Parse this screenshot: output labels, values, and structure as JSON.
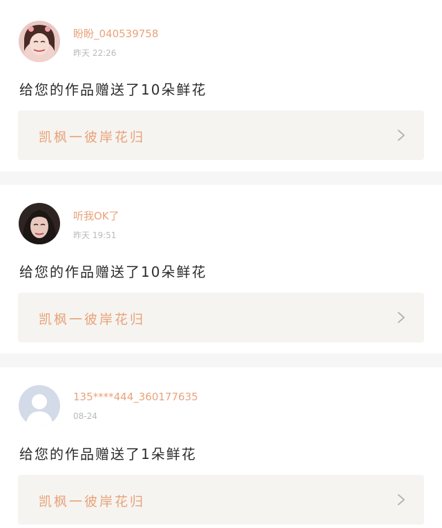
{
  "posts": [
    {
      "username": "盼盼_040539758",
      "time": "昨天 22:26",
      "message": "给您的作品赠送了10朵鲜花",
      "work_title": "凯枫一彼岸花归",
      "avatar_icon": "user-photo-avatar",
      "chevron_icon": "chevron-right-icon"
    },
    {
      "username": "听我OK了",
      "time": "昨天 19:51",
      "message": "给您的作品赠送了10朵鲜花",
      "work_title": "凯枫一彼岸花归",
      "avatar_icon": "user-photo-avatar",
      "chevron_icon": "chevron-right-icon"
    },
    {
      "username": "135****444_360177635",
      "time": "08-24",
      "message": "给您的作品赠送了1朵鲜花",
      "work_title": "凯枫一彼岸花归",
      "avatar_icon": "default-avatar",
      "chevron_icon": "chevron-right-icon"
    }
  ],
  "colors": {
    "accent": "#e9a27a",
    "timestamp": "#b9b9b9",
    "card_bg": "#f5f4f0",
    "separator": "#f6f6f6"
  }
}
